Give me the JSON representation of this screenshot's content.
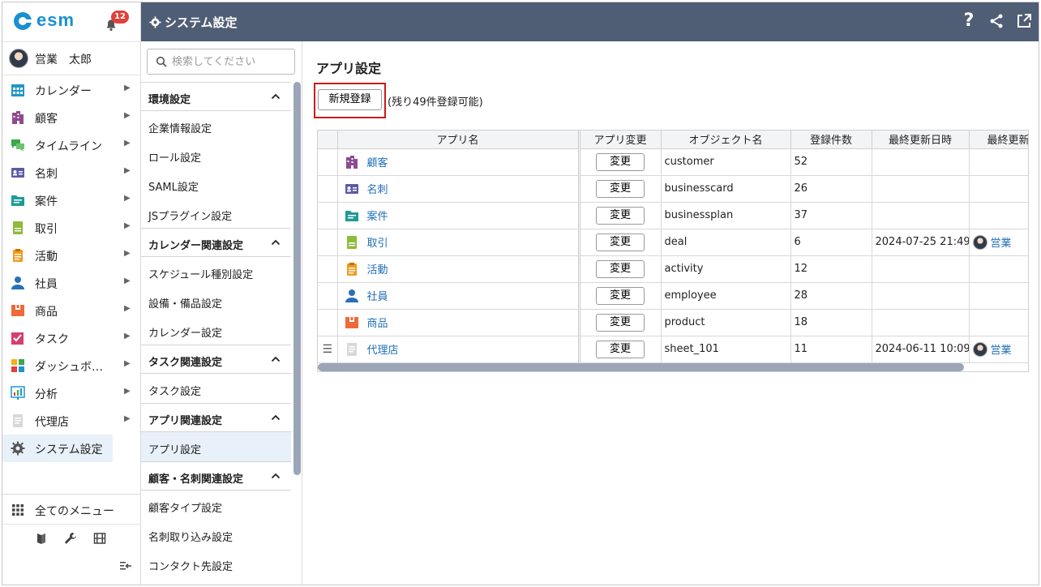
{
  "brand": {
    "logo_text": "esm",
    "notification_count": "12"
  },
  "user": {
    "name": "営業　太郎"
  },
  "nav": {
    "items": [
      {
        "label": "カレンダー",
        "icon": "calendar-icon",
        "color": "#2196c9"
      },
      {
        "label": "顧客",
        "icon": "building-icon",
        "color": "#8e4b8f"
      },
      {
        "label": "タイムライン",
        "icon": "chat-icon",
        "color": "#3aa84d"
      },
      {
        "label": "名刺",
        "icon": "business-card-icon",
        "color": "#5b5aa8"
      },
      {
        "label": "案件",
        "icon": "folder-icon",
        "color": "#1f9a9a"
      },
      {
        "label": "取引",
        "icon": "deal-icon",
        "color": "#8dbb3a"
      },
      {
        "label": "活動",
        "icon": "clipboard-icon",
        "color": "#f39a1e"
      },
      {
        "label": "社員",
        "icon": "person-icon",
        "color": "#2a6fb8"
      },
      {
        "label": "商品",
        "icon": "box-icon",
        "color": "#ef6a3a"
      },
      {
        "label": "タスク",
        "icon": "task-icon",
        "color": "#d63f6e"
      },
      {
        "label": "ダッシュボ…",
        "icon": "dashboard-icon",
        "color": "#e0413b"
      },
      {
        "label": "分析",
        "icon": "chart-icon",
        "color": "#2196c9"
      },
      {
        "label": "代理店",
        "icon": "document-icon",
        "color": "#b0b0b0"
      },
      {
        "label": "システム設定",
        "icon": "gear-icon",
        "color": "#555555"
      }
    ],
    "all_menu_label": "全てのメニュー"
  },
  "topbar": {
    "title": "システム設定",
    "bg_color": "#4f5d75"
  },
  "settings_panel": {
    "search_placeholder": "検索してください",
    "groups": [
      {
        "title": "環境設定",
        "items": [
          "企業情報設定",
          "ロール設定",
          "SAML設定",
          "JSプラグイン設定"
        ]
      },
      {
        "title": "カレンダー関連設定",
        "items": [
          "スケジュール種別設定",
          "設備・備品設定",
          "カレンダー設定"
        ]
      },
      {
        "title": "タスク関連設定",
        "items": [
          "タスク設定"
        ]
      },
      {
        "title": "アプリ関連設定",
        "items": [
          "アプリ設定"
        ]
      },
      {
        "title": "顧客・名刺関連設定",
        "items": [
          "顧客タイプ設定",
          "名刺取り込み設定",
          "コンタクト先設定"
        ]
      }
    ]
  },
  "main": {
    "title": "アプリ設定",
    "new_button": "新規登録",
    "remaining": "(残り49件登録可能)",
    "columns": [
      "アプリ名",
      "アプリ変更",
      "オブジェクト名",
      "登録件数",
      "最終更新日時",
      "最終更新"
    ],
    "change_label": "変更",
    "rows": [
      {
        "name": "顧客",
        "icon": "building-icon",
        "object": "customer",
        "count": "52",
        "updated_at": "",
        "updated_by": ""
      },
      {
        "name": "名刺",
        "icon": "business-card-icon",
        "object": "businesscard",
        "count": "26",
        "updated_at": "",
        "updated_by": ""
      },
      {
        "name": "案件",
        "icon": "folder-icon",
        "object": "businessplan",
        "count": "37",
        "updated_at": "",
        "updated_by": ""
      },
      {
        "name": "取引",
        "icon": "deal-icon",
        "object": "deal",
        "count": "6",
        "updated_at": "2024-07-25 21:49",
        "updated_by": "営業"
      },
      {
        "name": "活動",
        "icon": "clipboard-icon",
        "object": "activity",
        "count": "12",
        "updated_at": "",
        "updated_by": ""
      },
      {
        "name": "社員",
        "icon": "person-icon",
        "object": "employee",
        "count": "28",
        "updated_at": "",
        "updated_by": ""
      },
      {
        "name": "商品",
        "icon": "box-icon",
        "object": "product",
        "count": "18",
        "updated_at": "",
        "updated_by": ""
      },
      {
        "name": "代理店",
        "icon": "document-icon",
        "object": "sheet_101",
        "count": "11",
        "updated_at": "2024-06-11 10:09",
        "updated_by": "営業"
      }
    ]
  },
  "colors": {
    "accent_link": "#1f6fb5",
    "highlight_border": "#cc1a1a",
    "active_bg": "#e8f1fa"
  }
}
